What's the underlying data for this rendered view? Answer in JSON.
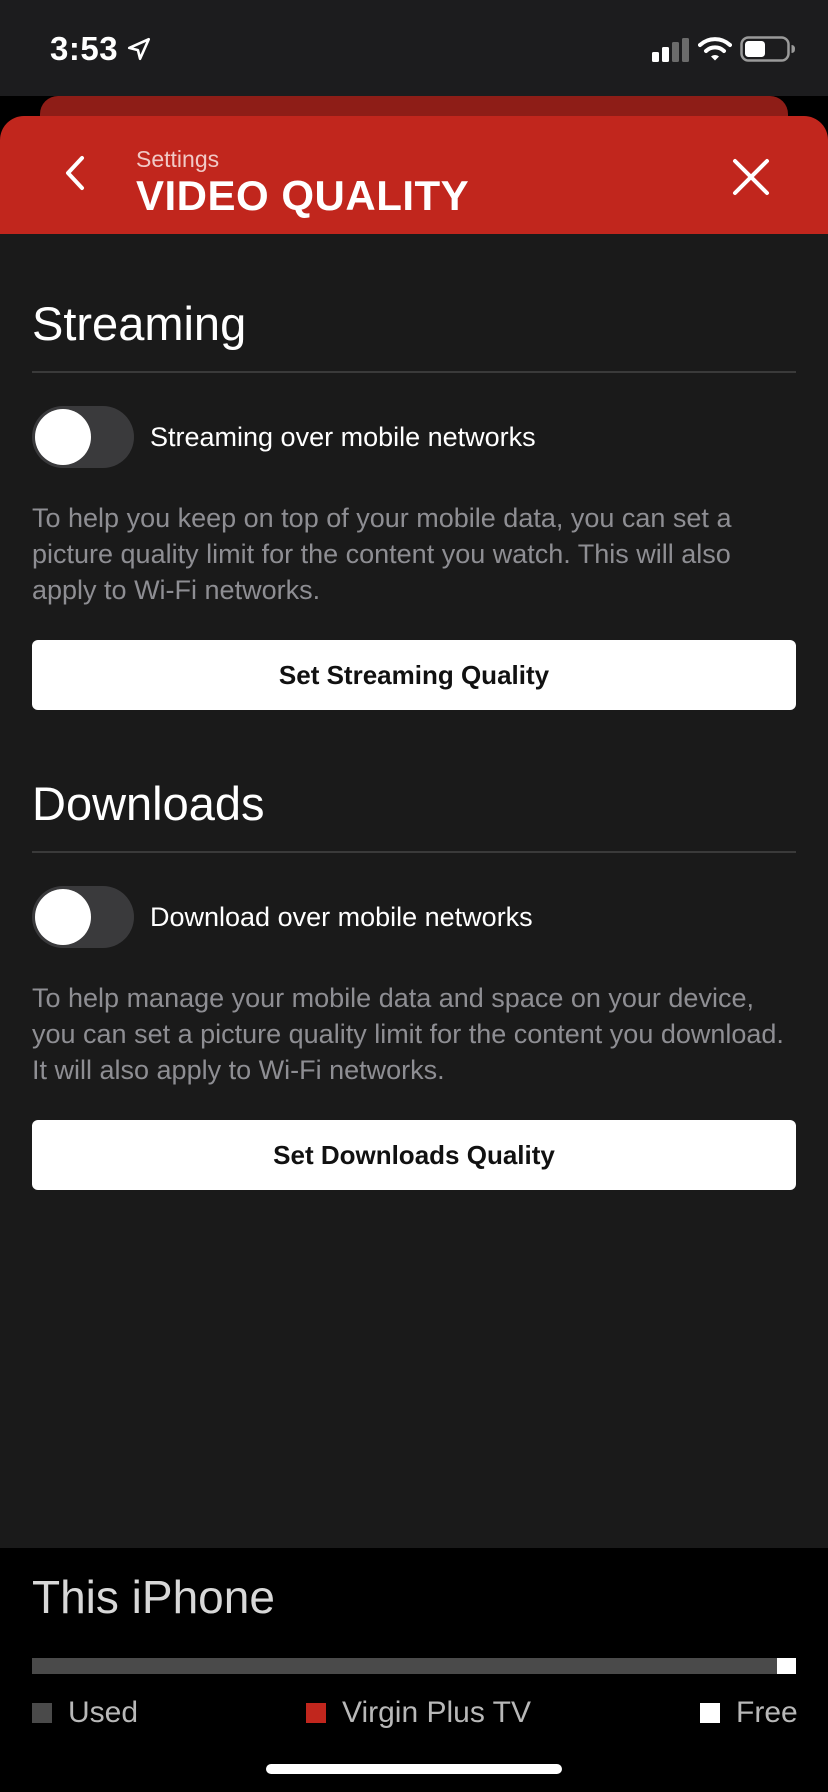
{
  "status_bar": {
    "time": "3:53"
  },
  "header": {
    "subtitle": "Settings",
    "title": "VIDEO QUALITY"
  },
  "streaming": {
    "title": "Streaming",
    "toggle_label": "Streaming over mobile networks",
    "toggle_on": false,
    "description": "To help you keep on top of your mobile data, you can set a picture quality limit for the content you watch. This will also apply to Wi-Fi networks.",
    "button_label": "Set Streaming Quality"
  },
  "downloads": {
    "title": "Downloads",
    "toggle_label": "Download over mobile networks",
    "toggle_on": false,
    "description": "To help manage your mobile data and space on your device, you can set a picture quality limit for the content you download. It will also apply to Wi-Fi networks.",
    "button_label": "Set Downloads Quality"
  },
  "storage": {
    "title": "This iPhone",
    "free_fraction": 0.025,
    "legend": [
      {
        "label": "Used",
        "color": "#4a4a4a"
      },
      {
        "label": "Virgin Plus TV",
        "color": "#c1261d"
      },
      {
        "label": "Free",
        "color": "#ffffff"
      }
    ]
  },
  "colors": {
    "accent": "#c1261d",
    "background": "#1a1a1a"
  }
}
